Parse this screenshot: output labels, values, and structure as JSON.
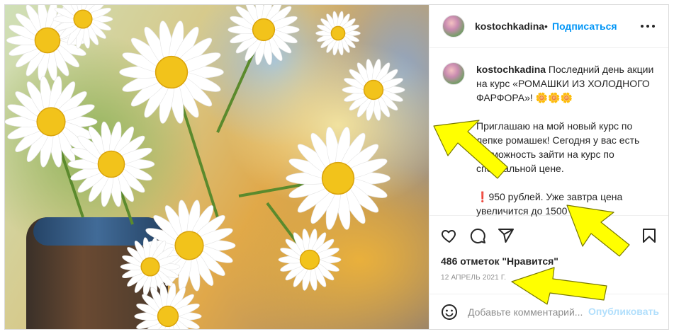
{
  "post": {
    "username": "kostochkadina",
    "separator": "•",
    "follow_label": "Подписаться",
    "more_icon": "more-horizontal-icon"
  },
  "caption": {
    "username": "kostochkadina",
    "line1": "Последний день акции на курс «РОМАШКИ ИЗ ХОЛОДНОГО ФАРФОРА»! 🌼🌼🌼",
    "line2": "Приглашаю на мой новый курс по лепке ромашек! Сегодня у вас есть возможность зайти на курс по специальной цене.",
    "line3_mark": "❗",
    "line3": "950 рублей. Уже завтра цена увеличится до 1500"
  },
  "actions": {
    "icons": [
      "heart-icon",
      "comment-icon",
      "share-icon",
      "bookmark-icon"
    ]
  },
  "likes_text": "486 отметок \"Нравится\"",
  "date_text": "12 АПРЕЛЬ 2021 Г.",
  "comment": {
    "placeholder": "Добавьте комментарий...",
    "publish_label": "Опубликовать"
  },
  "colors": {
    "accent": "#0095f6",
    "publish_disabled": "#b2dffc",
    "annotation_arrow": "#ffff00"
  }
}
